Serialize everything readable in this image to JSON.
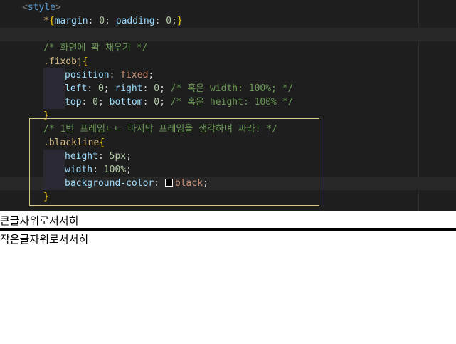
{
  "editor": {
    "lines": [
      {
        "indent": 0,
        "parts": [
          [
            "punct",
            "<"
          ],
          [
            "tag",
            "style"
          ],
          [
            "punct",
            ">"
          ]
        ]
      },
      {
        "indent": 1,
        "parts": [
          [
            "sel",
            "*"
          ],
          [
            "brace",
            "{"
          ],
          [
            "prop",
            "margin"
          ],
          [
            "txt",
            ": "
          ],
          [
            "num",
            "0"
          ],
          [
            "txt",
            "; "
          ],
          [
            "prop",
            "padding"
          ],
          [
            "txt",
            ": "
          ],
          [
            "num",
            "0"
          ],
          [
            "txt",
            ";"
          ],
          [
            "brace",
            "}"
          ]
        ]
      },
      {
        "indent": 0,
        "parts": [],
        "highlight": true
      },
      {
        "indent": 1,
        "parts": [
          [
            "comment",
            "/* 화면에 꽉 채우기 */"
          ]
        ]
      },
      {
        "indent": 1,
        "parts": [
          [
            "sel",
            ".fixobj"
          ],
          [
            "brace",
            "{"
          ]
        ]
      },
      {
        "indent": 2,
        "parts": [
          [
            "prop",
            "position"
          ],
          [
            "txt",
            ": "
          ],
          [
            "val",
            "fixed"
          ],
          [
            "txt",
            ";"
          ]
        ]
      },
      {
        "indent": 2,
        "parts": [
          [
            "prop",
            "left"
          ],
          [
            "txt",
            ": "
          ],
          [
            "num",
            "0"
          ],
          [
            "txt",
            "; "
          ],
          [
            "prop",
            "right"
          ],
          [
            "txt",
            ": "
          ],
          [
            "num",
            "0"
          ],
          [
            "txt",
            "; "
          ],
          [
            "comment",
            "/* 혹은 width: 100%; */"
          ]
        ]
      },
      {
        "indent": 2,
        "parts": [
          [
            "prop",
            "top"
          ],
          [
            "txt",
            ": "
          ],
          [
            "num",
            "0"
          ],
          [
            "txt",
            "; "
          ],
          [
            "prop",
            "bottom"
          ],
          [
            "txt",
            ": "
          ],
          [
            "num",
            "0"
          ],
          [
            "txt",
            "; "
          ],
          [
            "comment",
            "/* 혹은 height: 100% */"
          ]
        ]
      },
      {
        "indent": 1,
        "parts": [
          [
            "brace",
            "}"
          ]
        ]
      },
      {
        "indent": 1,
        "parts": [
          [
            "comment",
            "/* 1번 프레임ㄴㄴ 마지막 프레임을 생각하며 짜라! */"
          ]
        ]
      },
      {
        "indent": 1,
        "parts": [
          [
            "sel",
            ".blackline"
          ],
          [
            "brace",
            "{"
          ]
        ]
      },
      {
        "indent": 2,
        "parts": [
          [
            "prop",
            "height"
          ],
          [
            "txt",
            ": "
          ],
          [
            "num",
            "5px"
          ],
          [
            "txt",
            ";"
          ]
        ]
      },
      {
        "indent": 2,
        "parts": [
          [
            "prop",
            "width"
          ],
          [
            "txt",
            ": "
          ],
          [
            "num",
            "100%"
          ],
          [
            "txt",
            ";"
          ]
        ]
      },
      {
        "indent": 2,
        "parts": [
          [
            "prop",
            "background-color"
          ],
          [
            "txt",
            ": "
          ],
          [
            "swatch",
            ""
          ],
          [
            "val",
            "black"
          ],
          [
            "txt",
            ";"
          ]
        ],
        "highlight": true
      },
      {
        "indent": 1,
        "parts": [
          [
            "brace",
            "}"
          ]
        ]
      }
    ]
  },
  "preview": {
    "big_text": "큰글자위로서서히",
    "small_text": "작은글자위로서서히",
    "line_color": "#000000"
  }
}
